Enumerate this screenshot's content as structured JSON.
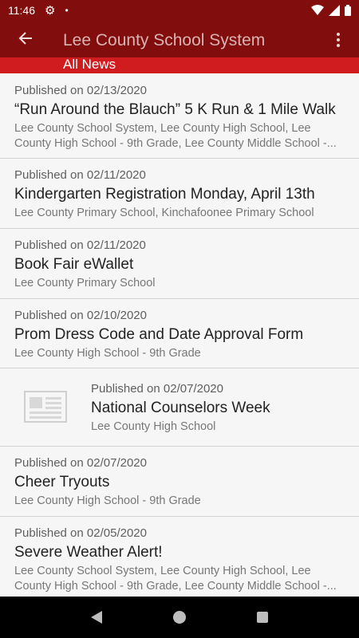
{
  "status": {
    "time": "11:46",
    "gear_icon": "gear-icon",
    "notification_dot": "•"
  },
  "app_bar": {
    "title": "Lee County School System",
    "subtitle": "All News"
  },
  "items": [
    {
      "date": "Published on 02/13/2020",
      "title": "“Run Around the Blauch”  5 K Run & 1 Mile Walk",
      "schools": "Lee County School System, Lee County High School, Lee County High School - 9th Grade, Lee County Middle School -..."
    },
    {
      "date": "Published on 02/11/2020",
      "title": "Kindergarten Registration Monday, April 13th",
      "schools": "Lee County Primary School, Kinchafoonee Primary School"
    },
    {
      "date": "Published on 02/11/2020",
      "title": "Book Fair eWallet",
      "schools": "Lee County Primary School"
    },
    {
      "date": "Published on 02/10/2020",
      "title": "Prom Dress Code and Date Approval Form",
      "schools": "Lee County High School - 9th Grade"
    },
    {
      "date": "Published on 02/07/2020",
      "title": "National Counselors Week",
      "schools": "Lee County High School"
    },
    {
      "date": "Published on 02/07/2020",
      "title": "Cheer Tryouts",
      "schools": "Lee County High School - 9th Grade"
    },
    {
      "date": "Published on 02/05/2020",
      "title": "Severe Weather Alert!",
      "schools": "Lee County School System, Lee County High School, Lee County High School - 9th Grade, Lee County Middle School -..."
    }
  ],
  "colors": {
    "primary_dark": "#820d0d",
    "accent_red": "#d01c1f"
  }
}
